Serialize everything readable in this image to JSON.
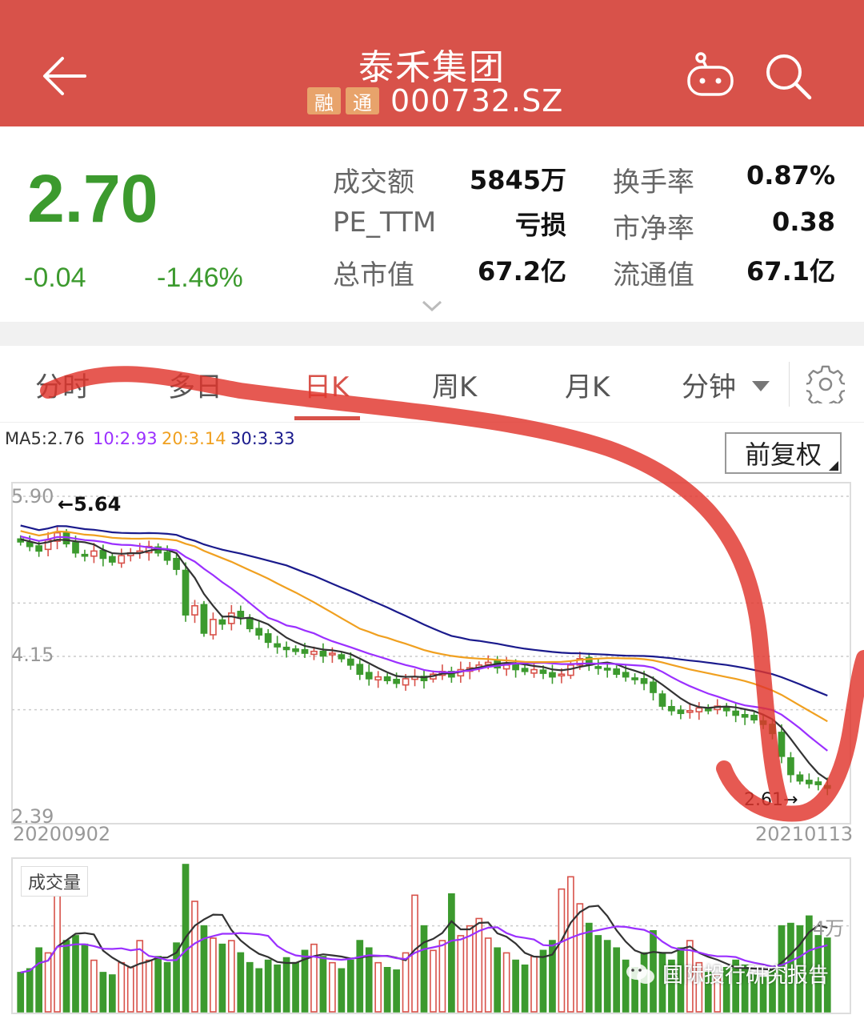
{
  "header": {
    "title": "泰禾集团",
    "tags": [
      "融",
      "通"
    ],
    "code": "000732.SZ"
  },
  "quote": {
    "price": "2.70",
    "change": "-0.04",
    "change_pct": "-1.46%",
    "stats": [
      {
        "label": "成交额",
        "value": "5845万"
      },
      {
        "label": "换手率",
        "value": "0.87%"
      },
      {
        "label": "PE_TTM",
        "value": "亏损"
      },
      {
        "label": "市净率",
        "value": "0.38"
      },
      {
        "label": "总市值",
        "value": "67.2亿"
      },
      {
        "label": "流通值",
        "value": "67.1亿"
      }
    ]
  },
  "tabs": [
    {
      "label": "分时"
    },
    {
      "label": "多日"
    },
    {
      "label": "日K"
    },
    {
      "label": "周K"
    },
    {
      "label": "月K"
    },
    {
      "label": "分钟"
    }
  ],
  "ma_legend": {
    "ma5": "MA5:2.76",
    "ma10": "10:2.93",
    "ma20": "20:3.14",
    "ma30": "30:3.33",
    "colors": {
      "ma5": "#333333",
      "ma10": "#9b30ff",
      "ma20": "#f0a020",
      "ma30": "#1a1a8c"
    }
  },
  "adjust_button": "前复权",
  "volume_label": "成交量",
  "watermark": "国际投行研究报告",
  "colors": {
    "header": "#d8524a",
    "down": "#3c9a2e",
    "up": "#d8524a",
    "accent": "#d8524a"
  },
  "chart_data": [
    {
      "type": "candlestick",
      "title": "",
      "x_start_label": "20200902",
      "x_end_label": "20210113",
      "y_tick_labels": [
        "5.90",
        "4.15",
        "2.39"
      ],
      "ylim": [
        2.39,
        5.9
      ],
      "max_marker": "←5.64",
      "min_marker": "2.61→",
      "grid": true,
      "close": [
        5.4,
        5.35,
        5.3,
        5.42,
        5.5,
        5.38,
        5.28,
        5.25,
        5.3,
        5.22,
        5.18,
        5.25,
        5.28,
        5.3,
        5.35,
        5.28,
        5.2,
        5.1,
        4.6,
        4.7,
        4.4,
        4.55,
        4.5,
        4.62,
        4.58,
        4.45,
        4.38,
        4.3,
        4.25,
        4.22,
        4.2,
        4.18,
        4.2,
        4.15,
        4.18,
        4.12,
        4.05,
        3.95,
        3.9,
        3.92,
        3.88,
        3.85,
        3.9,
        3.92,
        3.88,
        3.95,
        3.98,
        3.92,
        4.0,
        4.02,
        4.05,
        4.08,
        4.02,
        4.05,
        4.0,
        3.98,
        4.0,
        3.96,
        3.92,
        3.95,
        4.05,
        4.12,
        4.05,
        4.02,
        4.0,
        3.95,
        3.92,
        3.9,
        3.85,
        3.75,
        3.6,
        3.55,
        3.52,
        3.55,
        3.58,
        3.55,
        3.6,
        3.55,
        3.5,
        3.48,
        3.45,
        3.4,
        3.3,
        3.05,
        2.85,
        2.78,
        2.75,
        2.74,
        2.7
      ]
    },
    {
      "type": "bar",
      "title": "",
      "series_name": "成交量",
      "max_label": "4万",
      "values": [
        0.32,
        0.35,
        0.52,
        0.48,
        0.98,
        0.58,
        0.62,
        0.55,
        0.42,
        0.32,
        0.3,
        0.4,
        0.36,
        0.58,
        0.42,
        0.45,
        0.4,
        0.56,
        1.2,
        0.9,
        0.7,
        0.6,
        0.55,
        0.58,
        0.48,
        0.4,
        0.35,
        0.42,
        0.38,
        0.44,
        0.4,
        0.5,
        0.55,
        0.45,
        0.4,
        0.35,
        0.42,
        0.58,
        0.52,
        0.4,
        0.36,
        0.34,
        0.48,
        0.95,
        0.7,
        0.5,
        0.58,
        0.96,
        0.62,
        0.7,
        0.76,
        0.6,
        0.52,
        0.48,
        0.42,
        0.38,
        0.45,
        0.5,
        0.58,
        1.0,
        1.1,
        0.88,
        0.72,
        0.62,
        0.58,
        0.52,
        0.42,
        0.36,
        0.48,
        0.66,
        0.48,
        0.42,
        0.52,
        0.58,
        0.4,
        0.32,
        0.3,
        0.36,
        0.42,
        0.38,
        0.3,
        0.28,
        0.34,
        0.7,
        0.72,
        0.7,
        0.78,
        0.62,
        0.6
      ]
    }
  ]
}
